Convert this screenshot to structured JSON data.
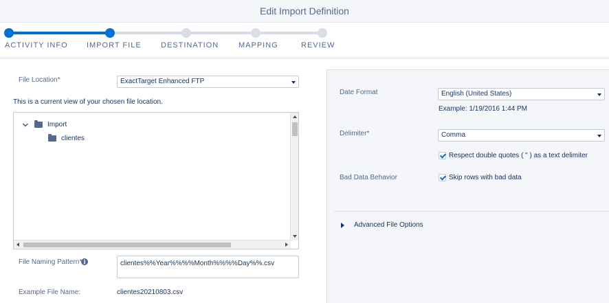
{
  "title": "Edit Import Definition",
  "stepper": {
    "steps": [
      {
        "label": "ACTIVITY INFO",
        "state": "complete"
      },
      {
        "label": "IMPORT FILE",
        "state": "current"
      },
      {
        "label": "DESTINATION",
        "state": "upcoming"
      },
      {
        "label": "MAPPING",
        "state": "upcoming"
      },
      {
        "label": "REVIEW",
        "state": "upcoming"
      }
    ]
  },
  "file_location": {
    "label": "File Location*",
    "value": "ExactTarget Enhanced FTP",
    "hint": "This is a current view of your chosen file location."
  },
  "file_tree": {
    "items": [
      {
        "label": "Import",
        "icon": "folder-open-icon",
        "expanded": true
      },
      {
        "label": "clientes",
        "icon": "folder-icon"
      }
    ]
  },
  "naming_pattern": {
    "label": "File Naming Pattern*",
    "value": "clientes%%Year%%%%Month%%%%Day%%.csv"
  },
  "example_file": {
    "label": "Example File Name:",
    "value": "clientes20210803.csv"
  },
  "date_format": {
    "label": "Date Format",
    "value": "English (United States)",
    "example": "Example: 1/19/2016 1:44 PM"
  },
  "delimiter": {
    "label": "Delimiter*",
    "value": "Comma",
    "respect_quotes_label": "Respect double quotes ( \" ) as a text delimiter",
    "respect_quotes_checked": true
  },
  "bad_data": {
    "label": "Bad Data Behavior",
    "skip_label": "Skip rows with bad data",
    "skip_checked": true
  },
  "advanced": {
    "label": "Advanced File Options"
  },
  "colors": {
    "accent": "#0070d2",
    "inactive": "#d8dde6",
    "text": "#16325c",
    "muted": "#54698d",
    "panel": "#f4f6f9"
  }
}
